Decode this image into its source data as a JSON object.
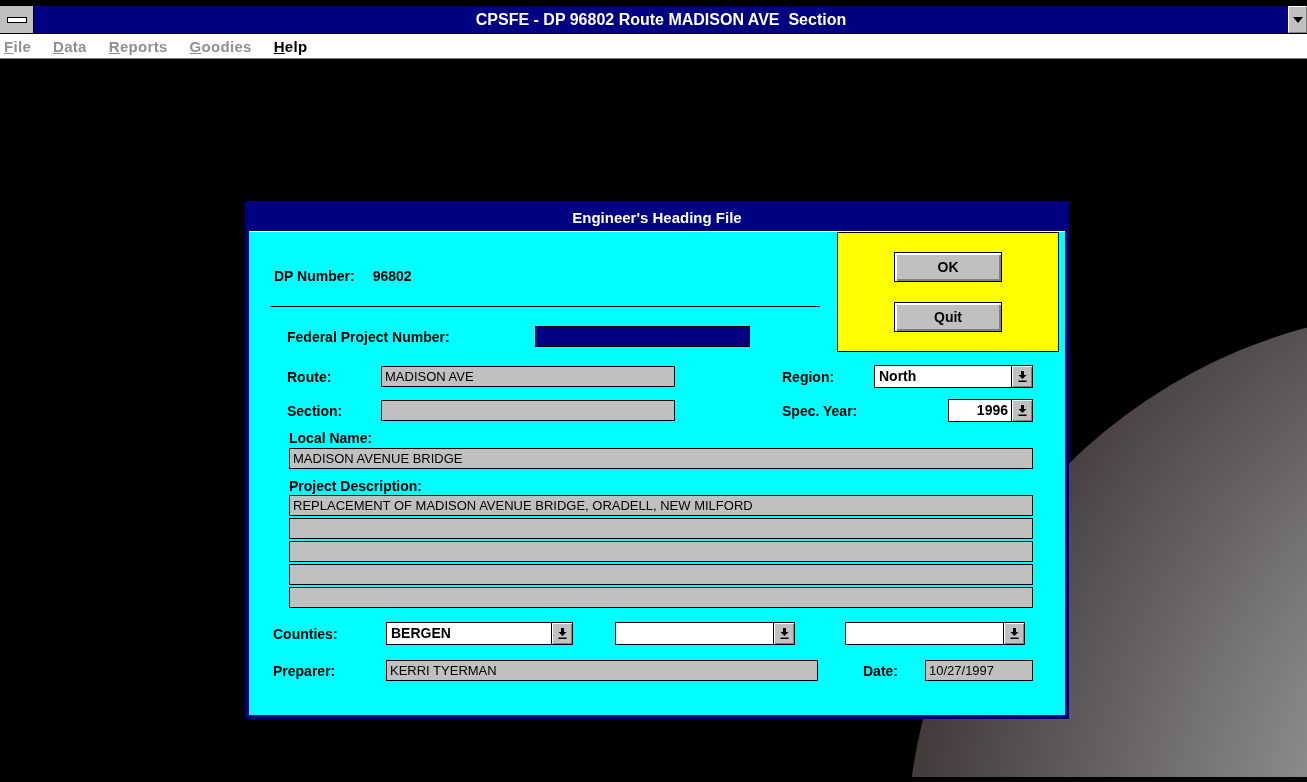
{
  "app_window": {
    "title": "CPSFE - DP 96802 Route MADISON AVE  Section"
  },
  "menu": [
    {
      "label": "File",
      "disabled": true
    },
    {
      "label": "Data",
      "disabled": true
    },
    {
      "label": "Reports",
      "disabled": true
    },
    {
      "label": "Goodies",
      "disabled": true
    },
    {
      "label": "Help",
      "disabled": false
    }
  ],
  "dialog": {
    "title": "Engineer's Heading File",
    "dp_number": {
      "label": "DP Number:",
      "value": "96802"
    },
    "federal_project_number": {
      "label": "Federal Project Number:",
      "focused": true
    },
    "buttons": [
      {
        "label": "OK"
      },
      {
        "label": "Quit"
      }
    ],
    "route": {
      "label": "Route:",
      "value": "MADISON AVE"
    },
    "section": {
      "label": "Section:"
    },
    "region": {
      "label": "Region:",
      "value": "North"
    },
    "spec_year": {
      "label": "Spec. Year:",
      "value": "1996"
    },
    "local_name": {
      "label": "Local Name:",
      "value": "MADISON AVENUE BRIDGE"
    },
    "project_description": {
      "label": "Project Description:",
      "lines": [
        {
          "kind": "text",
          "value": "REPLACEMENT OF MADISON AVENUE BRIDGE, ORADELL, NEW MILFORD"
        },
        {
          "kind": "blank"
        },
        {
          "kind": "blank"
        },
        {
          "kind": "blank"
        },
        {
          "kind": "blank"
        }
      ]
    },
    "counties": {
      "label": "Counties:",
      "selections": [
        {
          "kind": "chosen",
          "value": "BERGEN"
        },
        {
          "kind": "blank"
        },
        {
          "kind": "blank"
        }
      ]
    },
    "preparer": {
      "label": "Preparer:",
      "value": "KERRI TYERMAN"
    },
    "date": {
      "label": "Date:",
      "value": "10/27/1997"
    }
  }
}
